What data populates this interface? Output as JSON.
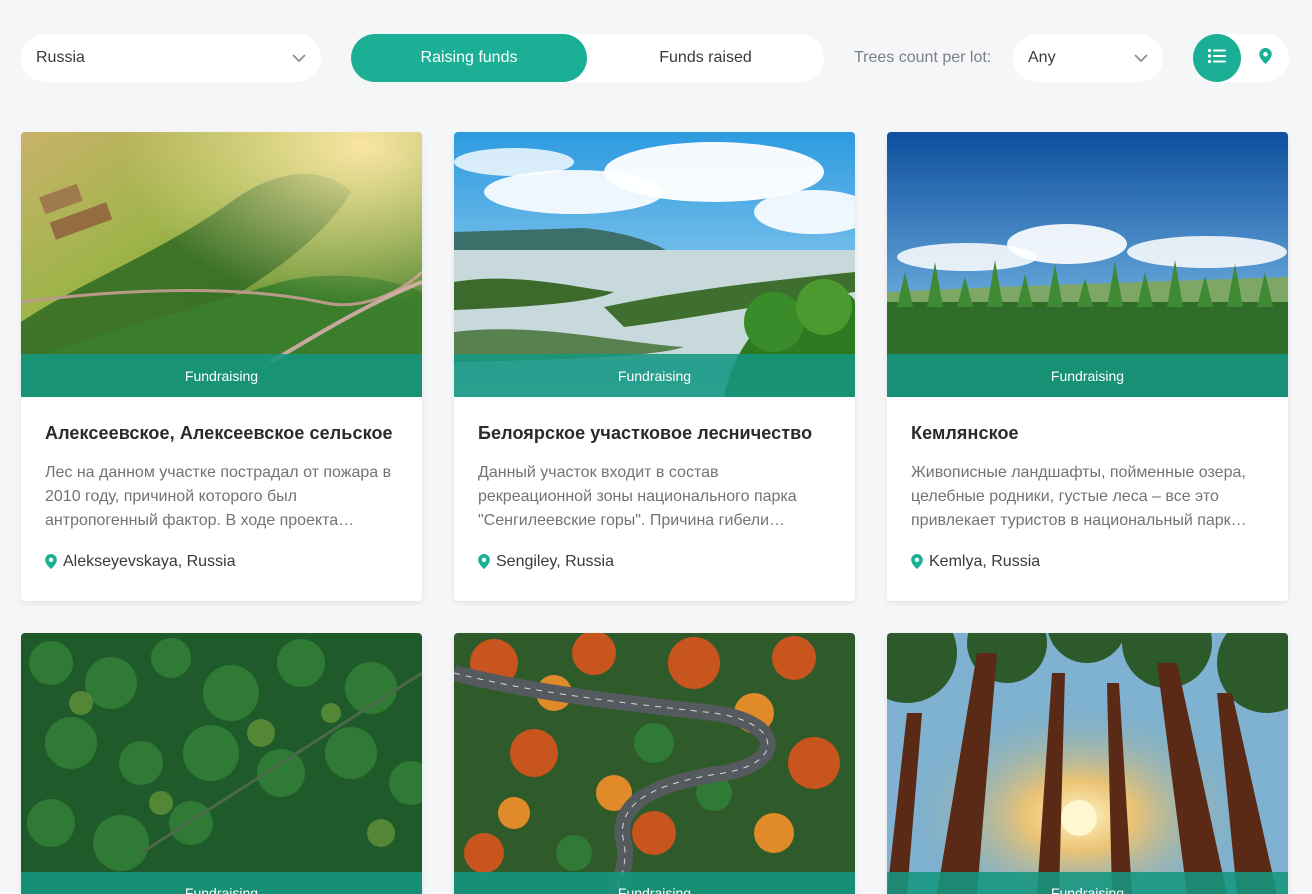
{
  "filters": {
    "country": "Russia",
    "tabs": {
      "active": "Raising funds",
      "inactive": "Funds raised"
    },
    "trees_label": "Trees count per lot:",
    "trees_value": "Any"
  },
  "view": {
    "list_icon": "list-icon",
    "map_icon": "map-pin-icon"
  },
  "colors": {
    "accent": "#1baf96",
    "badge": "#159680"
  },
  "cards": [
    {
      "badge": "Fundraising",
      "title": "Алексеевское, Алексеевское сельское",
      "description": "Лес на данном участке пострадал от пожара в 2010 году, причиной которого был антропогенный фактор. В ходе проекта…",
      "location": "Alekseyevskaya, Russia"
    },
    {
      "badge": "Fundraising",
      "title": "Белоярское участковое лесничество",
      "description": "Данный участок входит в состав рекреационной зоны национального парка \"Сенгилеевские горы\". Причина гибели…",
      "location": "Sengiley, Russia"
    },
    {
      "badge": "Fundraising",
      "title": "Кемлянское",
      "description": "Живописные ландшафты, пойменные озера, целебные родники, густые леса – все это привлекает туристов в национальный парк…",
      "location": "Kemlya, Russia"
    },
    {
      "badge": "Fundraising"
    },
    {
      "badge": "Fundraising"
    },
    {
      "badge": "Fundraising"
    }
  ]
}
